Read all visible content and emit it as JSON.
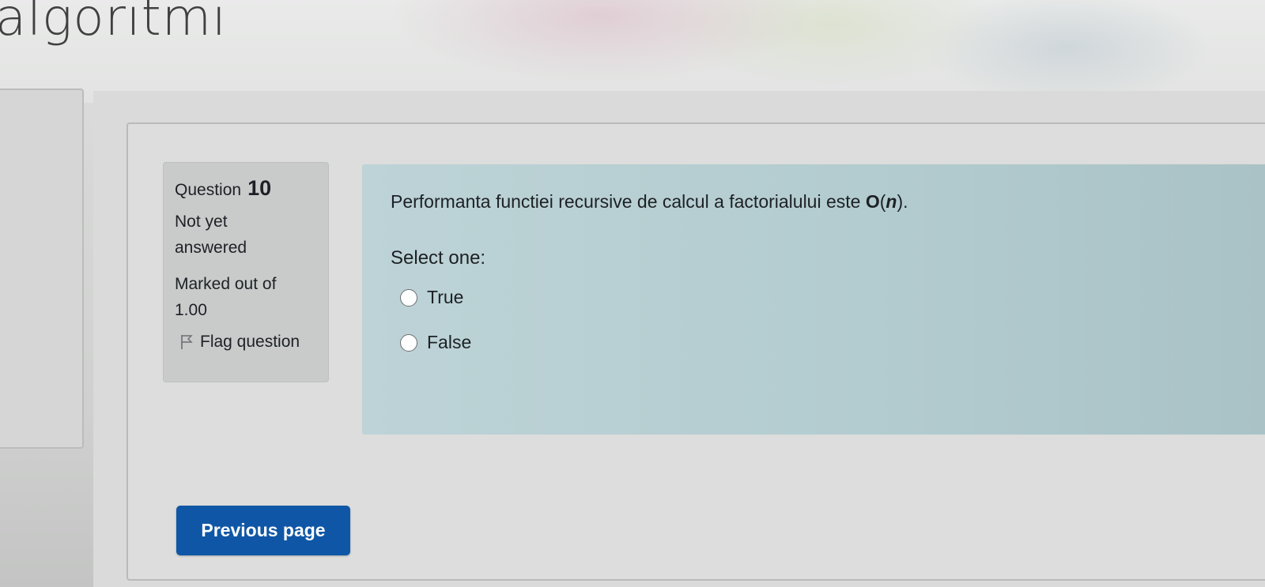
{
  "header": {
    "site_title": "algoritmi"
  },
  "question_info": {
    "label": "Question",
    "number": "10",
    "state": "Not yet answered",
    "grade": "Marked out of 1.00",
    "flag_label": "Flag question",
    "flag_icon": "flag-icon"
  },
  "question": {
    "text": "Performanta functiei recursive de calcul a factorialului este ",
    "complexity": "O",
    "complexity_paren_open": "(",
    "complexity_var": "n",
    "complexity_paren_close": ").",
    "prompt": "Select one:",
    "options": [
      {
        "label": "True",
        "selected": false
      },
      {
        "label": "False",
        "selected": false
      }
    ]
  },
  "navigation": {
    "previous_label": "Previous page"
  },
  "colors": {
    "primary_button": "#0f57a6",
    "formulation_bg": "#b3cccf",
    "info_bg": "#c9cbcb"
  }
}
